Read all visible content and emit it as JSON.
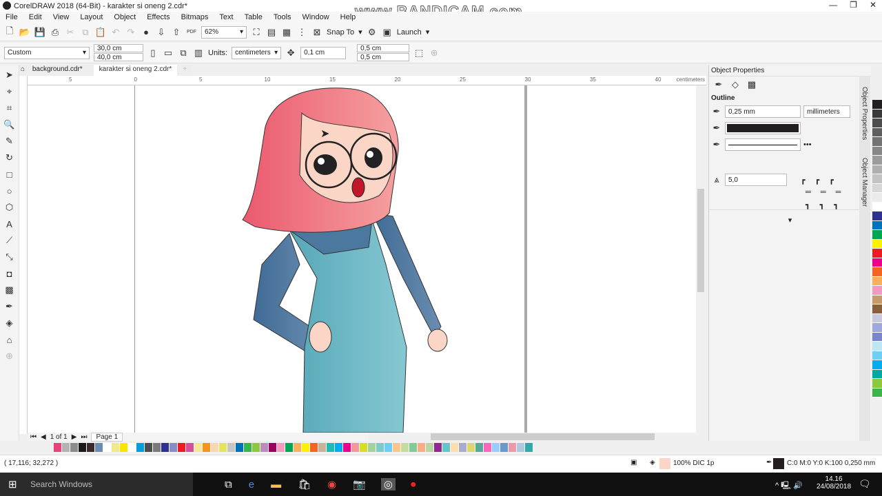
{
  "app": {
    "title": "CorelDRAW 2018 (64-Bit) - karakter si oneng 2.cdr*",
    "watermark": "www.BANDICAM.com"
  },
  "menu": [
    "File",
    "Edit",
    "View",
    "Layout",
    "Object",
    "Effects",
    "Bitmaps",
    "Text",
    "Table",
    "Tools",
    "Window",
    "Help"
  ],
  "toolbar": {
    "zoom": "62%",
    "snap_to": "Snap To",
    "launch": "Launch",
    "pdf": "PDF"
  },
  "propbar": {
    "page_size": "Custom",
    "width": "30,0 cm",
    "height": "40,0 cm",
    "units_label": "Units:",
    "units": "centimeters",
    "nudge": "0,1 cm",
    "dup_x": "0,5 cm",
    "dup_y": "0,5 cm"
  },
  "tabs": [
    "background.cdr*",
    "karakter si oneng 2.cdr*"
  ],
  "ruler": {
    "ticks": [
      "5",
      "0",
      "5",
      "10",
      "15",
      "20",
      "25",
      "30",
      "35",
      "40"
    ],
    "unit": "centimeters"
  },
  "pagenav": {
    "page_count": "1 of 1",
    "page_tab": "Page 1"
  },
  "object_properties": {
    "title": "Object Properties",
    "section": "Outline",
    "width": "0,25 mm",
    "units": "millimeters",
    "color": "#231f20",
    "miter": "5,0",
    "side_tabs": [
      "Object Properties",
      "Object Manager"
    ]
  },
  "palette": {
    "bottom": [
      "#e8417c",
      "#b3b3b3",
      "#8c8c8c",
      "#1a1a1a",
      "#3d2b2b",
      "#6b8cb0",
      "#fff",
      "#f2e98c",
      "#f6e600",
      "#ffffff",
      "#00a0e0",
      "#4d4d4d",
      "#7a7a7a",
      "#2e3192",
      "#8a8cc7",
      "#ed1c24",
      "#d64f9b",
      "#f7e799",
      "#f7941d",
      "#f6d9b0",
      "#e5e55c",
      "#c6c6c6",
      "#0072bc",
      "#39b54a",
      "#8dc63f",
      "#bd8cbf",
      "#9e005d",
      "#f49ac1",
      "#00a651",
      "#fbaf5d",
      "#fff200",
      "#f26522",
      "#c7b299",
      "#1cbbb4",
      "#00aeef",
      "#ec008c",
      "#f5989d",
      "#d7df23",
      "#a3d39c",
      "#7accc8",
      "#6dcff6",
      "#fdc689",
      "#c4df9b",
      "#82ca9c",
      "#f9ad81",
      "#b9d6a0",
      "#92278f",
      "#60c8c8",
      "#ffdead",
      "#aac",
      "#ddd86e",
      "#5a9",
      "#f6b",
      "#9cf",
      "#69c",
      "#e9a",
      "#acd",
      "#3aa"
    ],
    "right": [
      "#231f20",
      "#3a3a3a",
      "#4d4d4d",
      "#5f5f5f",
      "#737373",
      "#878787",
      "#9b9b9b",
      "#afafaf",
      "#c3c3c3",
      "#d7d7d7",
      "#ebebeb",
      "#ffffff",
      "#2e3192",
      "#0072bc",
      "#00a651",
      "#fff200",
      "#ed1c24",
      "#ec008c",
      "#f26522",
      "#fbaf5d",
      "#f49ac1",
      "#c69c6d",
      "#8b5e3c",
      "#c8c8e0",
      "#9fa8da",
      "#7986cb",
      "#bfe6f2",
      "#6dcff6",
      "#00aeef",
      "#00a99d",
      "#8dc63f",
      "#39b54a"
    ]
  },
  "status": {
    "coords": "( 17,116; 32,272 )",
    "fill": "100% DIC 1p",
    "fill_color": "#fbd6c6",
    "outline": "C:0 M:0 Y:0 K:100  0,250 mm",
    "outline_color": "#231f20"
  },
  "taskbar": {
    "search": "Search Windows",
    "time": "14.16",
    "date": "24/08/2018"
  }
}
